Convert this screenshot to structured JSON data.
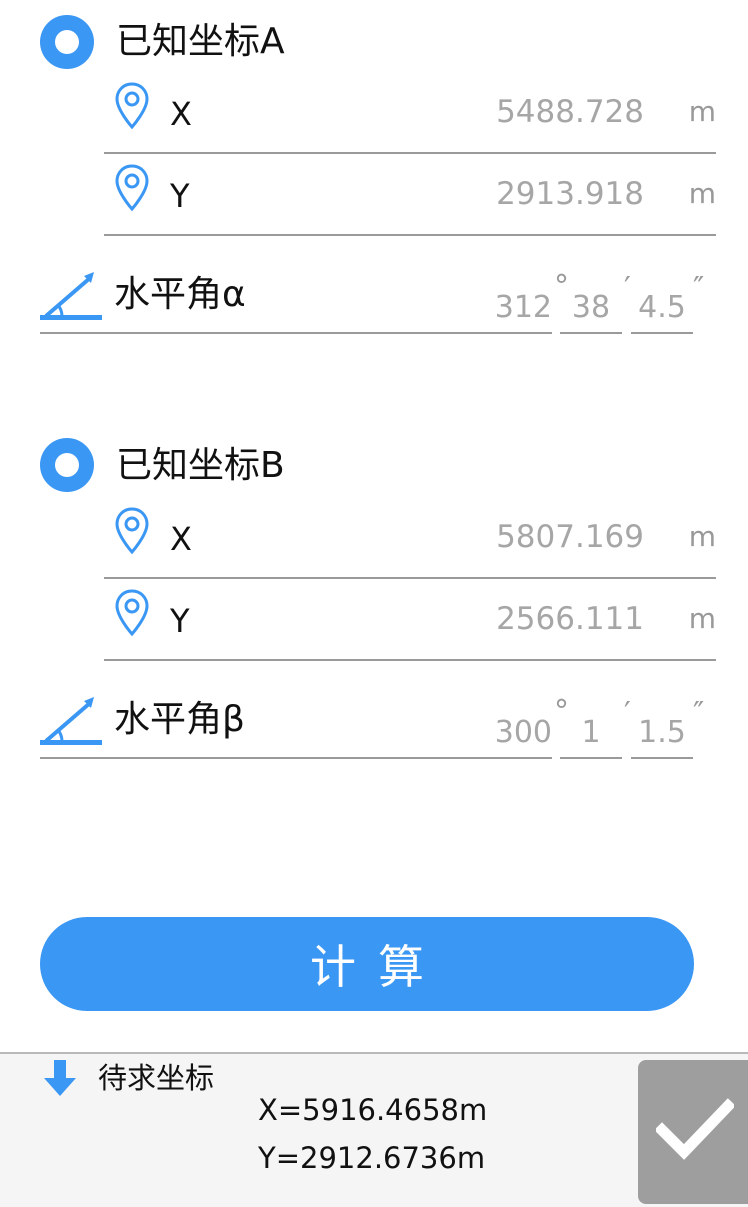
{
  "colors": {
    "accent": "#3a97f4",
    "value_text": "#a6a6a6",
    "divider": "#9a9a9a",
    "confirm_bg": "#9e9e9e"
  },
  "point_a": {
    "title": "已知坐标A",
    "x": {
      "label": "X",
      "value": "5488.728",
      "unit": "m"
    },
    "y": {
      "label": "Y",
      "value": "2913.918",
      "unit": "m"
    }
  },
  "angle_a": {
    "label": "水平角α",
    "degrees": "312",
    "minutes": "38",
    "seconds": "4.5",
    "deg_symbol": "°",
    "min_symbol": "′",
    "sec_symbol": "″"
  },
  "point_b": {
    "title": "已知坐标B",
    "x": {
      "label": "X",
      "value": "5807.169",
      "unit": "m"
    },
    "y": {
      "label": "Y",
      "value": "2566.111",
      "unit": "m"
    }
  },
  "angle_b": {
    "label": "水平角β",
    "degrees": "300",
    "minutes": "1",
    "seconds": "1.5",
    "deg_symbol": "°",
    "min_symbol": "′",
    "sec_symbol": "″"
  },
  "calculate_button": {
    "label": "计算"
  },
  "result": {
    "title": "待求坐标",
    "x_line": "X=5916.4658m",
    "y_line": "Y=2912.6736m"
  },
  "icons": {
    "radio": "radio-selected-icon",
    "pin": "location-pin-icon",
    "angle": "angle-icon",
    "down": "arrow-down-icon",
    "check": "checkmark-icon"
  }
}
